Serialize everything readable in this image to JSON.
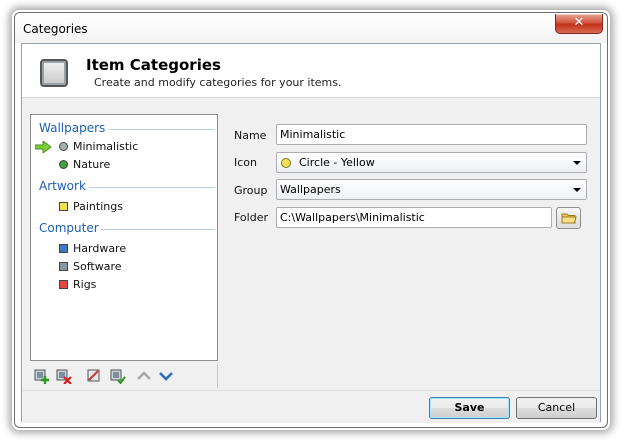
{
  "window": {
    "title": "Categories",
    "close_label": "✕"
  },
  "header": {
    "title": "Item Categories",
    "subtitle": "Create and modify categories for your items."
  },
  "tree": {
    "groups": [
      {
        "name": "Wallpapers",
        "items": [
          {
            "label": "Minimalistic",
            "color": "#8a9c9c",
            "shape": "circle",
            "selected": true
          },
          {
            "label": "Nature",
            "color": "#3fa33a",
            "shape": "circle"
          }
        ]
      },
      {
        "name": "Artwork",
        "items": [
          {
            "label": "Paintings",
            "color": "#efe252",
            "shape": "square"
          }
        ]
      },
      {
        "name": "Computer",
        "items": [
          {
            "label": "Hardware",
            "color": "#3f79bd",
            "shape": "square"
          },
          {
            "label": "Software",
            "color": "#8b97a0",
            "shape": "square"
          },
          {
            "label": "Rigs",
            "color": "#e04848",
            "shape": "square"
          }
        ]
      }
    ]
  },
  "toolbar": {
    "buttons": [
      "add-icon",
      "delete-icon",
      "edit-icon",
      "apply-icon",
      "move-up-icon",
      "move-down-icon"
    ]
  },
  "form": {
    "name_label": "Name",
    "name_value": "Minimalistic",
    "icon_label": "Icon",
    "icon_value": "Circle - Yellow",
    "group_label": "Group",
    "group_value": "Wallpapers",
    "folder_label": "Folder",
    "folder_value": "C:\\Wallpapers\\Minimalistic"
  },
  "footer": {
    "save_label": "Save",
    "cancel_label": "Cancel"
  }
}
